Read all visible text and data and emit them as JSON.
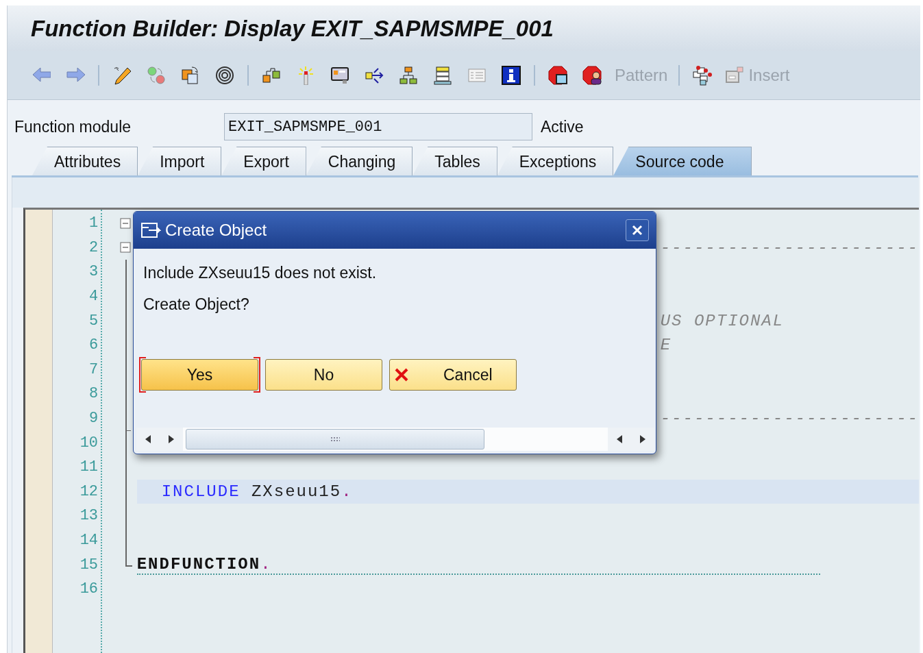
{
  "window": {
    "title": "Function Builder: Display EXIT_SAPMSMPE_001"
  },
  "toolbar": {
    "buttons": [
      {
        "kind": "text",
        "label": "Pattern",
        "disabled": true
      },
      {
        "kind": "icon-text",
        "label": "Insert",
        "disabled": true
      }
    ]
  },
  "header": {
    "label": "Function module",
    "value": "EXIT_SAPMSMPE_001",
    "status": "Active"
  },
  "tabs": [
    {
      "label": "Attributes",
      "selected": false
    },
    {
      "label": "Import",
      "selected": false
    },
    {
      "label": "Export",
      "selected": false
    },
    {
      "label": "Changing",
      "selected": false
    },
    {
      "label": "Tables",
      "selected": false
    },
    {
      "label": "Exceptions",
      "selected": false
    },
    {
      "label": "Source code",
      "selected": true
    }
  ],
  "editor": {
    "lines": [
      {
        "number": "1",
        "kind": "fold-start"
      },
      {
        "number": "2",
        "kind": "fold-start",
        "behind_dialog": true,
        "tokens": [
          {
            "kind": "comment",
            "text": "-----------------------"
          }
        ]
      },
      {
        "number": "3",
        "kind": "fold-body"
      },
      {
        "number": "4",
        "kind": "fold-body"
      },
      {
        "number": "5",
        "kind": "fold-body",
        "behind_dialog": true,
        "tokens": [
          {
            "kind": "comment",
            "text": "US OPTIONAL"
          }
        ]
      },
      {
        "number": "6",
        "kind": "fold-body",
        "behind_dialog": true,
        "tokens": [
          {
            "kind": "comment",
            "text": "E"
          }
        ]
      },
      {
        "number": "7",
        "kind": "fold-body"
      },
      {
        "number": "8",
        "kind": "fold-body"
      },
      {
        "number": "9",
        "kind": "fold-tick",
        "behind_dialog": true,
        "tokens": [
          {
            "kind": "comment",
            "text": "-----------------------"
          }
        ]
      },
      {
        "number": "10",
        "kind": "fold-body"
      },
      {
        "number": "11",
        "kind": "fold-body"
      },
      {
        "number": "12",
        "kind": "fold-body",
        "current": true,
        "indented": true,
        "tokens": [
          {
            "kind": "keyword",
            "text": "INCLUDE"
          },
          {
            "kind": "plain",
            "text": " ZXseuu15"
          },
          {
            "kind": "punct",
            "text": "."
          }
        ]
      },
      {
        "number": "13",
        "kind": "fold-body"
      },
      {
        "number": "14",
        "kind": "fold-body"
      },
      {
        "number": "15",
        "kind": "fold-end",
        "block_end": true,
        "tokens": [
          {
            "kind": "bold",
            "text": "ENDFUNCTION"
          },
          {
            "kind": "punct",
            "text": "."
          }
        ]
      },
      {
        "number": "16",
        "kind": "plain"
      }
    ]
  },
  "dialog": {
    "title": "Create Object",
    "messages": [
      "Include ZXseuu15 does not exist.",
      "Create Object?"
    ],
    "buttons": [
      {
        "kind": "plain",
        "label": "Yes",
        "focused": true
      },
      {
        "kind": "plain",
        "label": "No",
        "focused": false
      },
      {
        "kind": "cancel",
        "label": "Cancel",
        "focused": false
      }
    ]
  }
}
